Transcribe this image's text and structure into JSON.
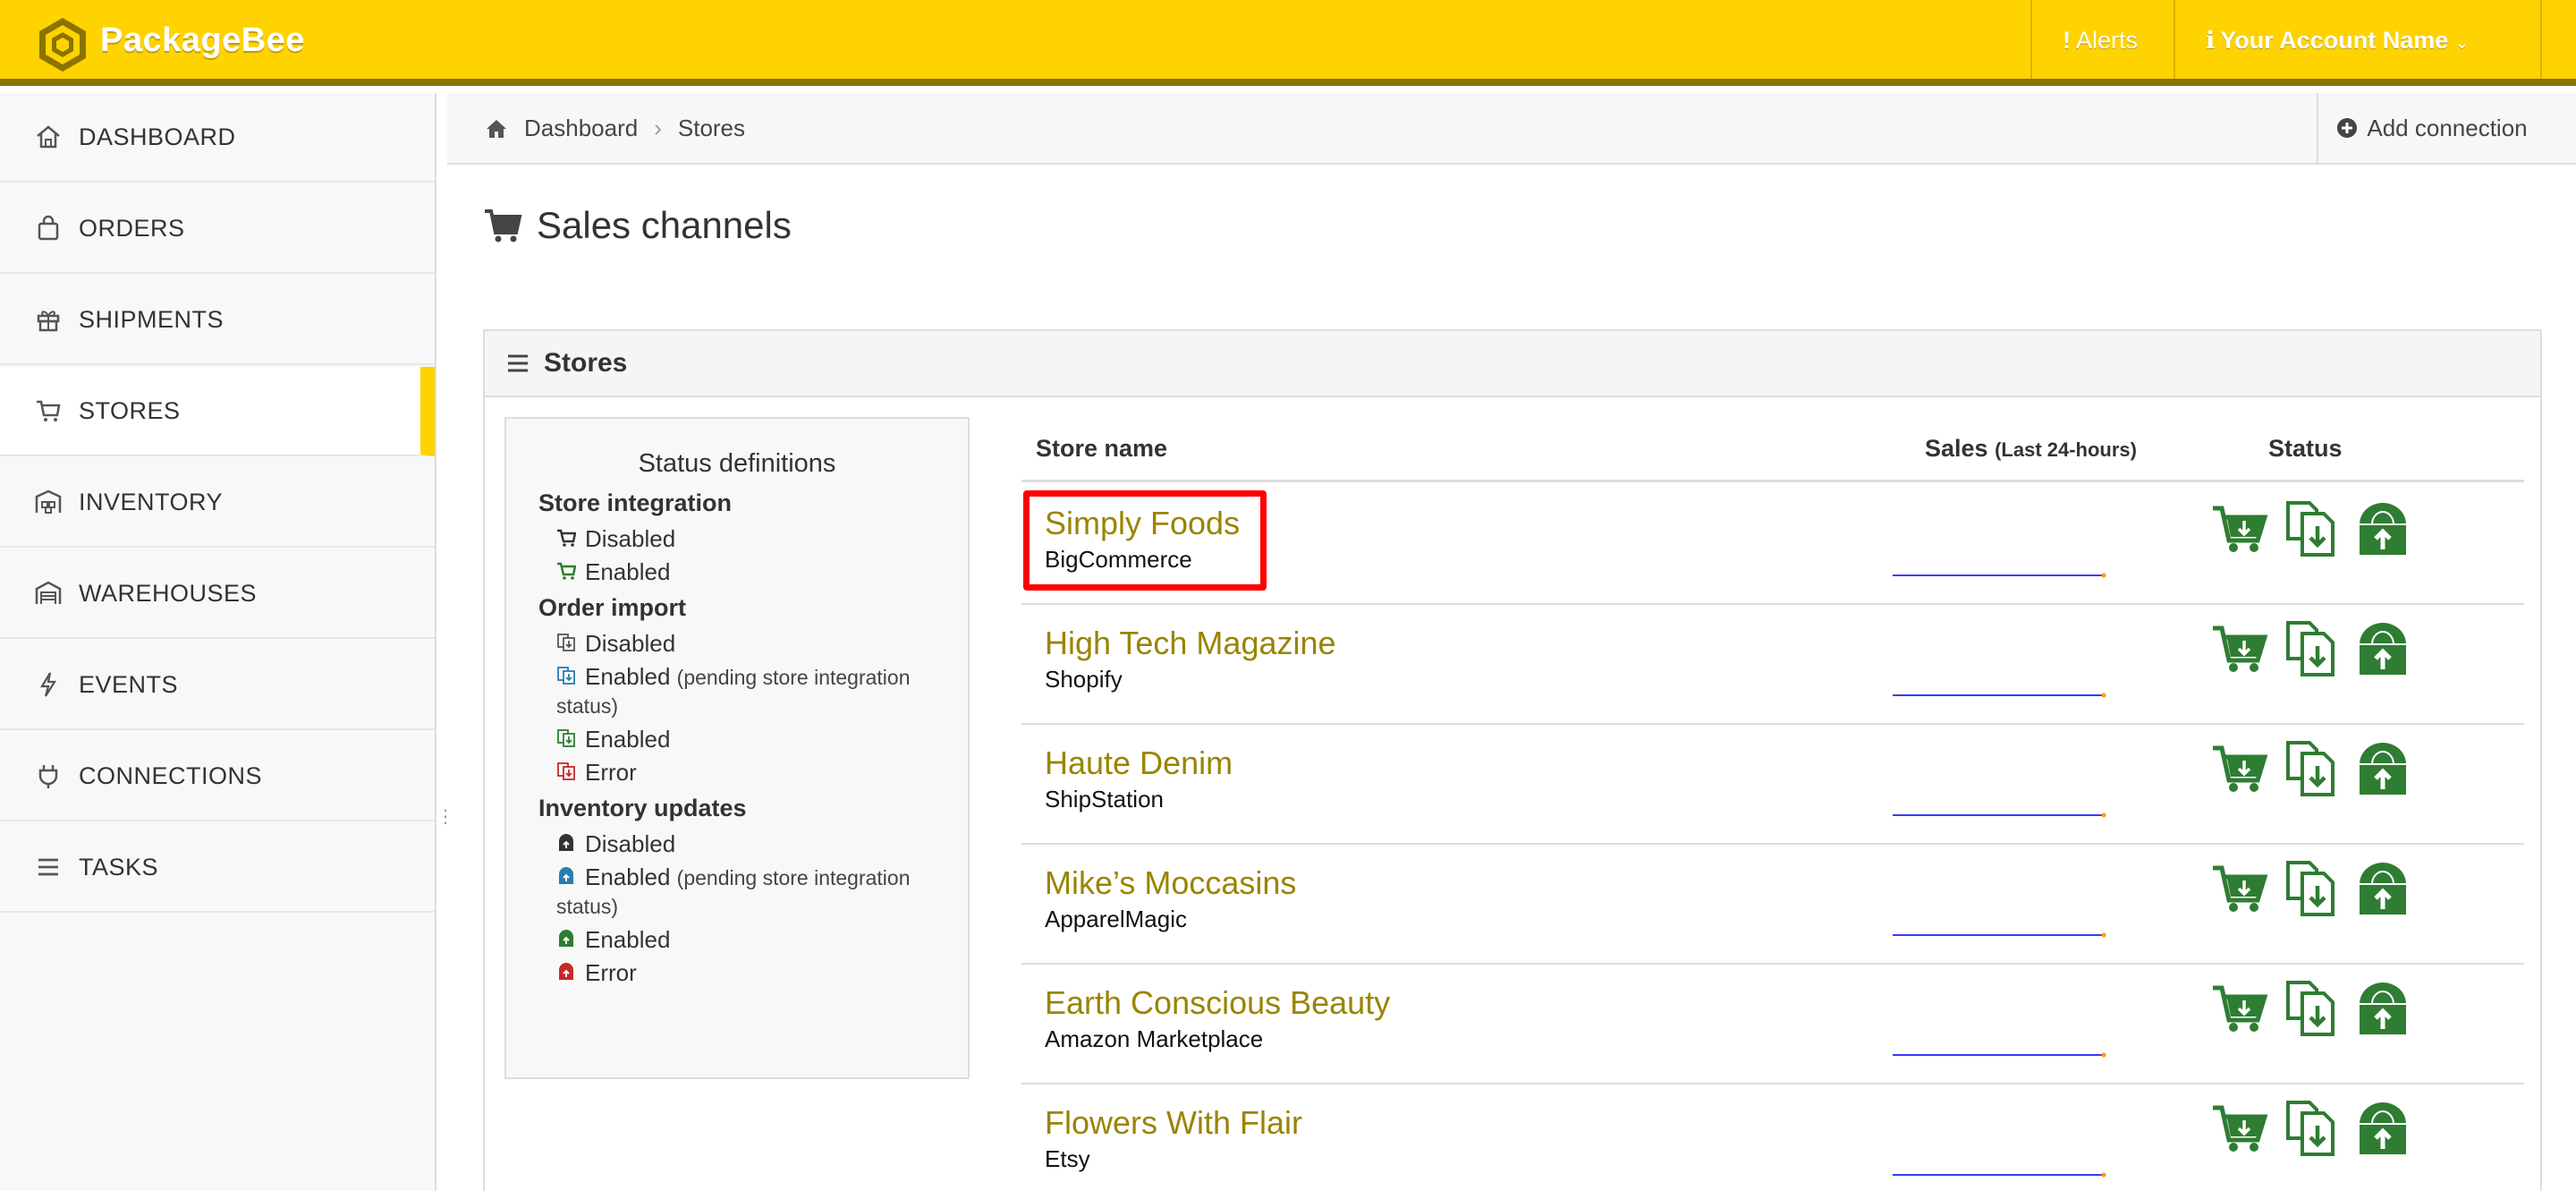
{
  "app": {
    "brand": "PackageBee"
  },
  "topbar": {
    "alerts_label": "Alerts",
    "account_label": "Your Account Name",
    "icons": {
      "logo": "hexagon-logo-icon",
      "alerts": "exclamation-icon",
      "account": "info-icon",
      "caret": "chevron-down-icon"
    }
  },
  "sidebar": {
    "items": [
      {
        "label": "DASHBOARD",
        "icon": "home-icon"
      },
      {
        "label": "ORDERS",
        "icon": "bag-icon"
      },
      {
        "label": "SHIPMENTS",
        "icon": "gift-icon"
      },
      {
        "label": "STORES",
        "icon": "cart-icon",
        "active": true
      },
      {
        "label": "INVENTORY",
        "icon": "inventory-icon"
      },
      {
        "label": "WAREHOUSES",
        "icon": "warehouse-icon"
      },
      {
        "label": "EVENTS",
        "icon": "bolt-icon"
      },
      {
        "label": "CONNECTIONS",
        "icon": "plug-icon"
      },
      {
        "label": "TASKS",
        "icon": "list-icon"
      }
    ]
  },
  "breadcrumb": {
    "home": "Dashboard",
    "current": "Stores",
    "separator": "›"
  },
  "header": {
    "add_connection": "Add connection"
  },
  "page": {
    "title": "Sales channels"
  },
  "panel": {
    "title": "Stores"
  },
  "definitions": {
    "title": "Status definitions",
    "groups": [
      {
        "title": "Store integration",
        "rows": [
          {
            "label": "Disabled",
            "note": "",
            "icon": "cart-icon",
            "color": "#333333"
          },
          {
            "label": "Enabled",
            "note": "",
            "icon": "cart-icon",
            "color": "#2E7D32"
          }
        ]
      },
      {
        "title": "Order import",
        "rows": [
          {
            "label": "Disabled",
            "note": "",
            "icon": "order-import-icon",
            "color": "#555555"
          },
          {
            "label": "Enabled",
            "note": "(pending store integration",
            "note2": "status)",
            "icon": "order-import-icon",
            "color": "#2A7BB0"
          },
          {
            "label": "Enabled",
            "note": "",
            "icon": "order-import-icon",
            "color": "#2E7D32"
          },
          {
            "label": "Error",
            "note": "",
            "icon": "order-import-icon",
            "color": "#C62828"
          }
        ]
      },
      {
        "title": "Inventory updates",
        "rows": [
          {
            "label": "Disabled",
            "note": "",
            "icon": "inventory-upload-icon",
            "color": "#333333"
          },
          {
            "label": "Enabled",
            "note": "(pending store integration",
            "note2": "status)",
            "icon": "inventory-upload-icon",
            "color": "#2A7BB0"
          },
          {
            "label": "Enabled",
            "note": "",
            "icon": "inventory-upload-icon",
            "color": "#2E7D32"
          },
          {
            "label": "Error",
            "note": "",
            "icon": "inventory-upload-icon",
            "color": "#C62828"
          }
        ]
      }
    ]
  },
  "table": {
    "col_store": "Store name",
    "col_sales": "Sales",
    "col_sales_note": "(Last 24-hours)",
    "col_status": "Status",
    "rows": [
      {
        "name": "Simply Foods",
        "platform": "BigCommerce",
        "highlighted": true
      },
      {
        "name": "High Tech Magazine",
        "platform": "Shopify"
      },
      {
        "name": "Haute Denim",
        "platform": "ShipStation"
      },
      {
        "name": "Mike’s Moccasins",
        "platform": "ApparelMagic"
      },
      {
        "name": "Earth Conscious Beauty",
        "platform": "Amazon Marketplace"
      },
      {
        "name": "Flowers With Flair",
        "platform": "Etsy"
      }
    ]
  },
  "colors": {
    "brand_yellow": "#FFD300",
    "brand_dark": "#8A7300",
    "link_gold": "#9A8400",
    "status_green": "#2E7D32",
    "highlight_red": "#FF0000",
    "sparkline_blue": "#3B3BFF",
    "sparkline_dot": "#FF9900"
  }
}
